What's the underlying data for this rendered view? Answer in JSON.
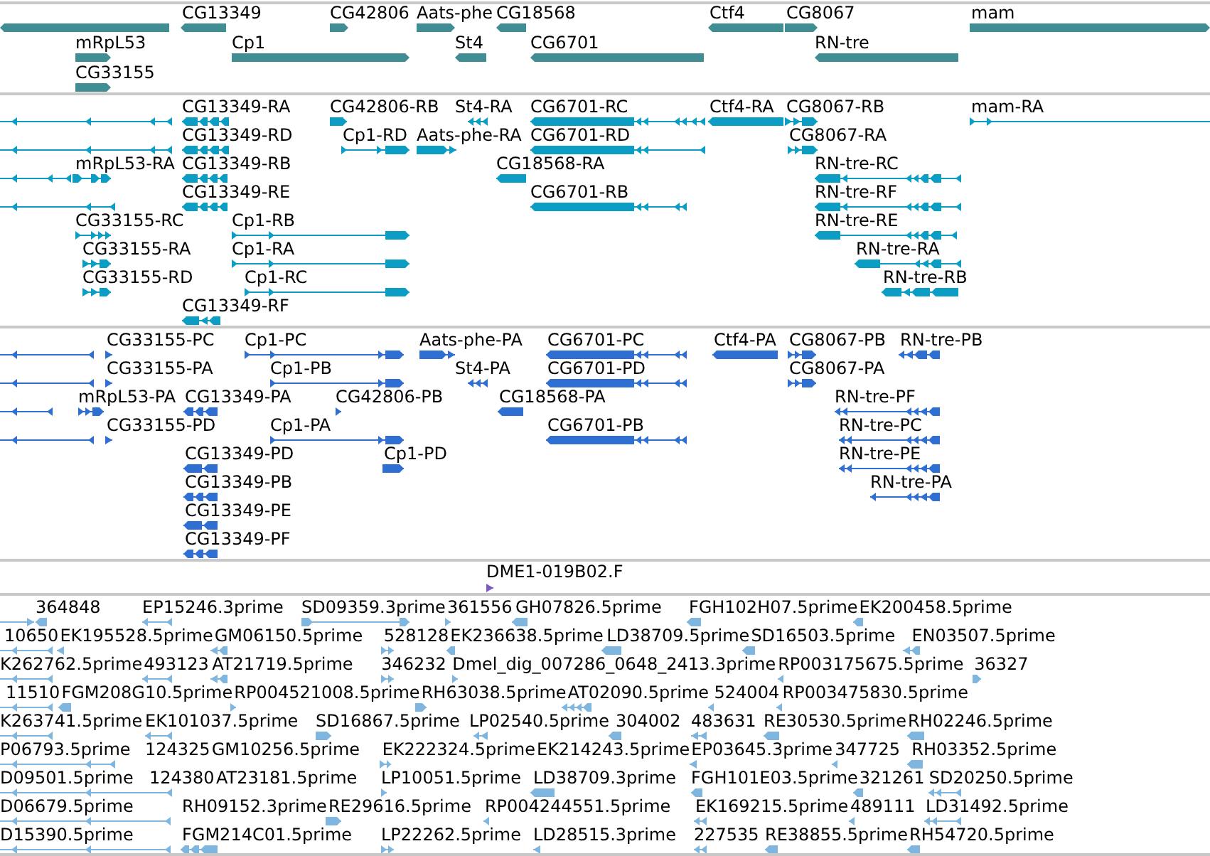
{
  "tracks": [
    {
      "kind": "gene",
      "color": "#408e94",
      "features": [
        {
          "reverse": true
        },
        {
          "label": "CG13349",
          "reverse": true
        },
        {
          "label": "CG42806",
          "reverse": false
        },
        {
          "label": "Aats-phe",
          "reverse": false
        },
        {
          "label": "CG18568",
          "reverse": true
        },
        {
          "label": "Ctf4",
          "reverse": true
        },
        {
          "label": "CG8067",
          "reverse": false
        },
        {
          "label": "mam",
          "reverse": false
        },
        {
          "label": "mRpL53",
          "reverse": false
        },
        {
          "label": "Cp1",
          "reverse": false
        },
        {
          "label": "St4",
          "reverse": true
        },
        {
          "label": "CG6701",
          "reverse": true
        },
        {
          "label": "RN-tre",
          "reverse": true
        },
        {
          "label": "CG33155",
          "reverse": false
        }
      ]
    },
    {
      "kind": "transcript",
      "color": "#0b9dc3",
      "features": [
        {
          "reverse": true
        },
        {
          "label": "CG13349-RA",
          "reverse": true
        },
        {
          "label": "CG42806-RB",
          "reverse": false
        },
        {
          "label": "St4-RA",
          "reverse": true
        },
        {
          "label": "CG6701-RC",
          "reverse": true
        },
        {
          "label": "Ctf4-RA",
          "reverse": true
        },
        {
          "label": "CG8067-RB",
          "reverse": false
        },
        {
          "label": "mam-RA",
          "reverse": false
        },
        {
          "reverse": true
        },
        {
          "label": "CG13349-RD",
          "reverse": true
        },
        {
          "label": "Cp1-RD",
          "reverse": false
        },
        {
          "label": "Aats-phe-RA",
          "reverse": false
        },
        {
          "label": "CG6701-RD",
          "reverse": true
        },
        {
          "label": "CG8067-RA",
          "reverse": false
        },
        {
          "reverse": true
        },
        {
          "label": "mRpL53-RA",
          "reverse": false
        },
        {
          "label": "CG13349-RB",
          "reverse": true
        },
        {
          "label": "CG18568-RA",
          "reverse": true
        },
        {
          "label": "RN-tre-RC",
          "reverse": true
        },
        {
          "reverse": true
        },
        {
          "label": "CG13349-RE",
          "reverse": true
        },
        {
          "label": "CG6701-RB",
          "reverse": true
        },
        {
          "label": "RN-tre-RF",
          "reverse": true
        },
        {
          "label": "CG33155-RC",
          "reverse": false
        },
        {
          "label": "Cp1-RB",
          "reverse": false
        },
        {
          "label": "RN-tre-RE",
          "reverse": true
        },
        {
          "label": "CG33155-RA",
          "reverse": false
        },
        {
          "label": "Cp1-RA",
          "reverse": false
        },
        {
          "label": "RN-tre-RA",
          "reverse": true
        },
        {
          "label": "CG33155-RD",
          "reverse": false
        },
        {
          "label": "Cp1-RC",
          "reverse": false
        },
        {
          "label": "RN-tre-RB",
          "reverse": true
        },
        {
          "label": "CG13349-RF",
          "reverse": true
        }
      ]
    },
    {
      "kind": "protein",
      "color": "#2f6fd1",
      "features": [
        {
          "reverse": true
        },
        {
          "label": "CG33155-PC",
          "reverse": false
        },
        {
          "label": "Cp1-PC",
          "reverse": false
        },
        {
          "label": "Aats-phe-PA",
          "reverse": false
        },
        {
          "label": "CG6701-PC",
          "reverse": true
        },
        {
          "label": "Ctf4-PA",
          "reverse": true
        },
        {
          "label": "CG8067-PB",
          "reverse": false
        },
        {
          "label": "RN-tre-PB",
          "reverse": true
        },
        {
          "reverse": true
        },
        {
          "label": "CG33155-PA",
          "reverse": false
        },
        {
          "label": "Cp1-PB",
          "reverse": false
        },
        {
          "label": "St4-PA",
          "reverse": true
        },
        {
          "label": "CG6701-PD",
          "reverse": true
        },
        {
          "label": "CG8067-PA",
          "reverse": false
        },
        {
          "reverse": true
        },
        {
          "label": "mRpL53-PA",
          "reverse": false
        },
        {
          "label": "CG13349-PA",
          "reverse": true
        },
        {
          "label": "CG42806-PB",
          "reverse": false
        },
        {
          "label": "CG18568-PA",
          "reverse": true
        },
        {
          "label": "RN-tre-PF",
          "reverse": true
        },
        {
          "reverse": true
        },
        {
          "label": "CG33155-PD",
          "reverse": false
        },
        {
          "label": "Cp1-PA",
          "reverse": false
        },
        {
          "label": "CG6701-PB",
          "reverse": true
        },
        {
          "label": "RN-tre-PC",
          "reverse": true
        },
        {
          "label": "CG13349-PD",
          "reverse": true
        },
        {
          "label": "Cp1-PD",
          "reverse": false
        },
        {
          "label": "RN-tre-PE",
          "reverse": true
        },
        {
          "label": "CG13349-PB",
          "reverse": true
        },
        {
          "label": "RN-tre-PA",
          "reverse": true
        },
        {
          "label": "CG13349-PE",
          "reverse": true
        },
        {
          "label": "CG13349-PF",
          "reverse": true
        }
      ]
    },
    {
      "kind": "clone_end",
      "color": "#7a5cc4",
      "features": [
        {
          "label": "DME1-019B02.F",
          "reverse": false
        }
      ]
    },
    {
      "kind": "est",
      "color": "#7fb6df",
      "features": [
        {
          "reverse": false
        },
        {
          "label": "364848",
          "reverse": true
        },
        {
          "label": "EP15246.3prime",
          "reverse": true
        },
        {
          "label": "SD09359.3prime",
          "reverse": false
        },
        {
          "label": "361556",
          "reverse": false
        },
        {
          "label": "GH07826.5prime",
          "reverse": true
        },
        {
          "label": "FGH102H07.5prime",
          "reverse": true
        },
        {
          "label": "EK200458.5prime",
          "reverse": true
        },
        {
          "label": "10650",
          "reverse": true
        },
        {
          "label": "EK195528.5prime",
          "reverse": true
        },
        {
          "label": "GM06150.5prime",
          "reverse": true
        },
        {
          "label": "528128",
          "reverse": false
        },
        {
          "label": "EK236638.5prime",
          "reverse": true
        },
        {
          "label": "LD38709.5prime",
          "reverse": true
        },
        {
          "label": "SD16503.5prime",
          "reverse": true
        },
        {
          "label": "EN03507.5prime",
          "reverse": true
        },
        {
          "label": "K262762.5prime",
          "reverse": true
        },
        {
          "label": "493123",
          "reverse": true
        },
        {
          "label": "AT21719.5prime",
          "reverse": true
        },
        {
          "label": "346232",
          "reverse": false
        },
        {
          "label": "Dmel_dig_007286_0648_2413.3prime",
          "reverse": false
        },
        {
          "label": "RP003175675.5prime",
          "reverse": true
        },
        {
          "label": "36327",
          "reverse": false
        },
        {
          "label": "11510",
          "reverse": true
        },
        {
          "label": "FGM208G10.5prime",
          "reverse": true
        },
        {
          "label": "RP004521008.5prime",
          "reverse": false
        },
        {
          "label": "RH63038.5prime",
          "reverse": false
        },
        {
          "label": "AT02090.5prime",
          "reverse": true
        },
        {
          "label": "524004",
          "reverse": true
        },
        {
          "label": "RP003475830.5prime",
          "reverse": true
        },
        {
          "label": "K263741.5prime",
          "reverse": true
        },
        {
          "label": "EK101037.5prime",
          "reverse": true
        },
        {
          "label": "SD16867.5prime",
          "reverse": false
        },
        {
          "label": "LP02540.5prime",
          "reverse": true
        },
        {
          "label": "304002",
          "reverse": true
        },
        {
          "label": "483631",
          "reverse": true
        },
        {
          "label": "RE30530.5prime",
          "reverse": true
        },
        {
          "label": "RH02246.5prime",
          "reverse": true
        },
        {
          "label": "P06793.5prime",
          "reverse": true
        },
        {
          "label": "124325"
        },
        {
          "label": "GM10256.5prime"
        },
        {
          "label": "EK222324.5prime",
          "reverse": false
        },
        {
          "label": "EK214243.5prime"
        },
        {
          "label": "EP03645.3prime",
          "reverse": true
        },
        {
          "label": "347725",
          "reverse": true
        },
        {
          "label": "RH03352.5prime",
          "reverse": true
        },
        {
          "label": "D09501.5prime",
          "reverse": true
        },
        {
          "label": "124380"
        },
        {
          "label": "AT23181.5prime"
        },
        {
          "label": "LP10051.5prime",
          "reverse": false
        },
        {
          "label": "LD38709.3prime",
          "reverse": true
        },
        {
          "label": "FGH101E03.5prime",
          "reverse": true
        },
        {
          "label": "321261",
          "reverse": true
        },
        {
          "label": "SD20250.5prime",
          "reverse": true
        },
        {
          "label": "D06679.5prime",
          "reverse": true
        },
        {
          "label": "RH09152.3prime"
        },
        {
          "label": "RE29616.5prime",
          "reverse": false
        },
        {
          "label": "RP004244551.5prime",
          "reverse": true
        },
        {
          "label": "EK169215.5prime",
          "reverse": true
        },
        {
          "label": "489111",
          "reverse": true
        },
        {
          "label": "LD31492.5prime",
          "reverse": true
        },
        {
          "label": "D15390.5prime",
          "reverse": true
        },
        {
          "label": "FGM214C01.5prime",
          "reverse": true
        },
        {
          "label": "LP22262.5prime",
          "reverse": false
        },
        {
          "label": "LD28515.3prime",
          "reverse": true
        },
        {
          "label": "227535",
          "reverse": true
        },
        {
          "label": "RE38855.5prime",
          "reverse": true
        },
        {
          "label": "RH54720.5prime",
          "reverse": true
        }
      ]
    }
  ]
}
